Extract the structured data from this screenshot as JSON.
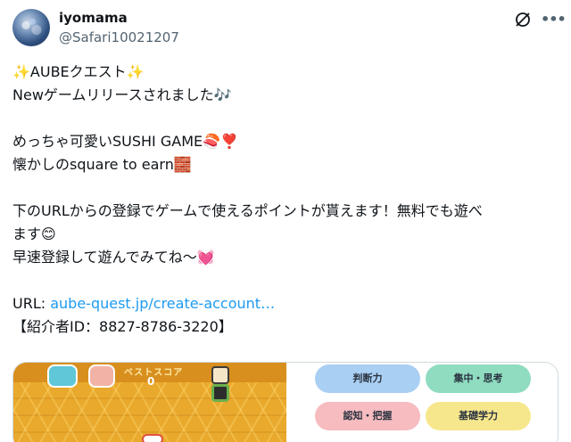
{
  "post": {
    "author_name": "iyomama",
    "author_handle": "@Safari10021207",
    "lines": [
      "✨AUBEクエスト✨",
      "Newゲームリリースされました🎶",
      "",
      "めっちゃ可愛いSUSHI GAME🍣❣️",
      "懐かしのsquare to earn🧱",
      "",
      "下のURLからの登録でゲームで使えるポイントが貰えます！無料でも遊べ",
      "ます😊",
      "早速登録して遊んでみてね〜💓",
      ""
    ],
    "url_prefix": "URL: ",
    "url_text": "aube-quest.jp/create-account…",
    "referral": "【紹介者ID：8827-8786-3220】"
  },
  "media": {
    "game": {
      "score_label": "ベストスコア",
      "score_value": "0"
    },
    "skills": [
      "判断力",
      "集中・思考",
      "認知・把握",
      "基礎学力"
    ]
  },
  "icons": {
    "grok": "grok-icon",
    "more": "more-icon"
  },
  "colors": {
    "link": "#1d9bf0",
    "secondary_text": "#536471",
    "game_bg": "#e9a92c"
  }
}
